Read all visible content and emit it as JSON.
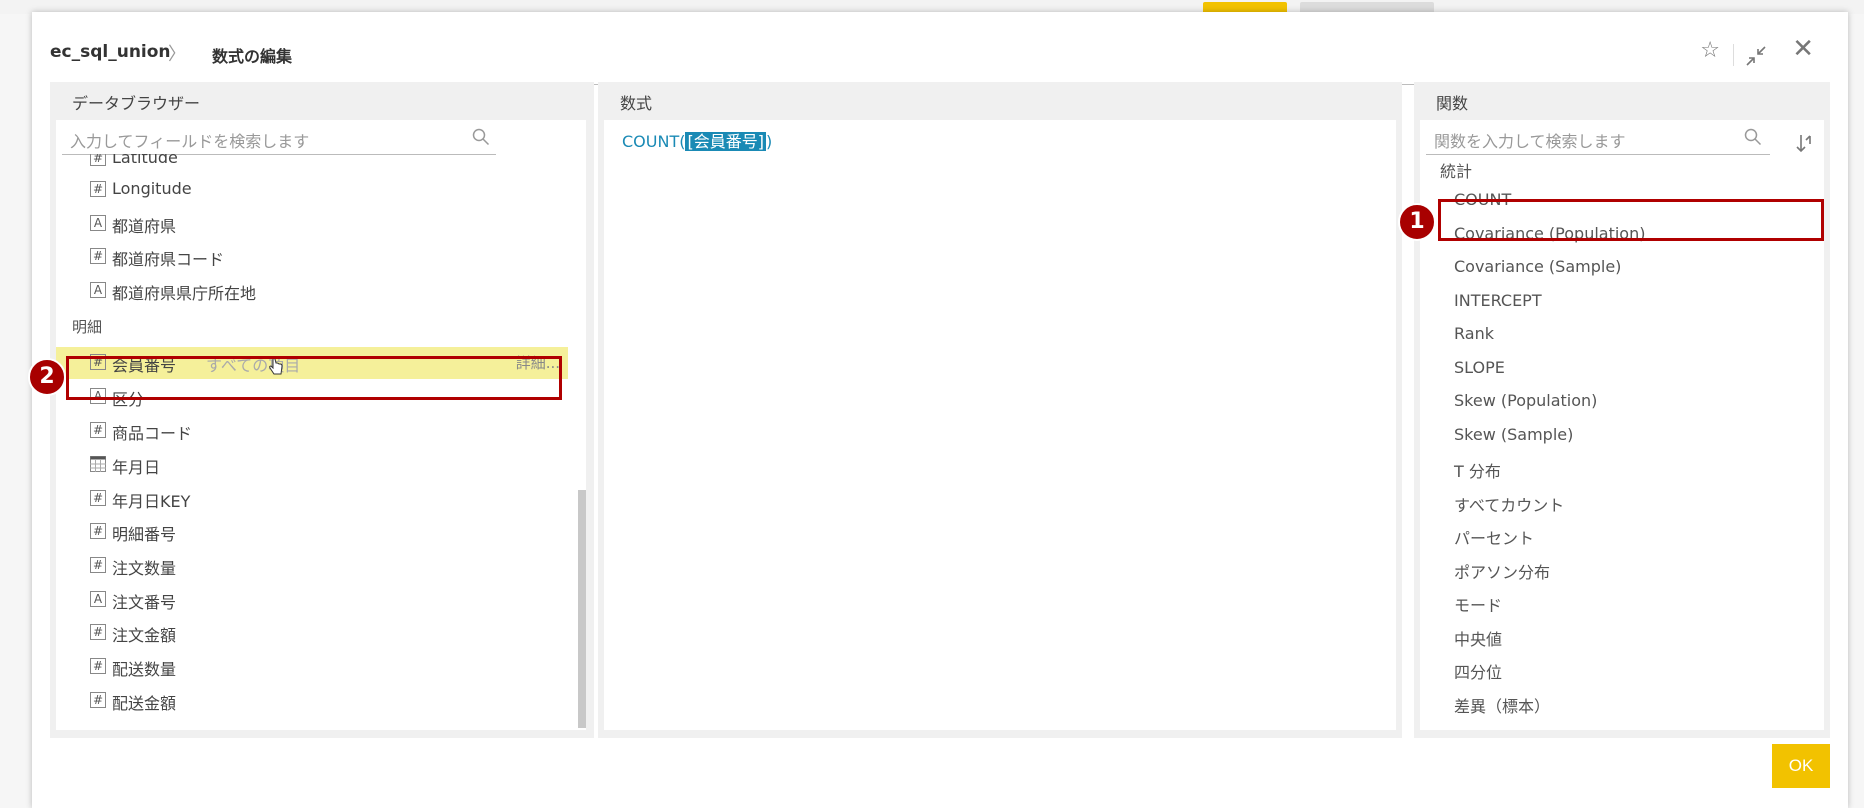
{
  "header": {
    "datasource": "ec_sql_union",
    "separator": "〉",
    "title": "数式の編集"
  },
  "data_browser": {
    "title": "データブラウザー",
    "search_placeholder": "入力してフィールドを検索します",
    "fields_top": [
      {
        "type": "#",
        "label": "Latitude"
      },
      {
        "type": "#",
        "label": "Longitude"
      },
      {
        "type": "A",
        "label": "都道府県"
      },
      {
        "type": "#",
        "label": "都道府県コード"
      },
      {
        "type": "A",
        "label": "都道府県県庁所在地"
      }
    ],
    "section": "明細",
    "highlighted_field": {
      "type": "#",
      "label": "会員番号",
      "sub": "すべての項目",
      "detail": "詳細..."
    },
    "fields_bottom": [
      {
        "type": "A",
        "label": "区分"
      },
      {
        "type": "#",
        "label": "商品コード"
      },
      {
        "type": "cal",
        "label": "年月日"
      },
      {
        "type": "#",
        "label": "年月日KEY"
      },
      {
        "type": "#",
        "label": "明細番号"
      },
      {
        "type": "#",
        "label": "注文数量"
      },
      {
        "type": "A",
        "label": "注文番号"
      },
      {
        "type": "#",
        "label": "注文金額"
      },
      {
        "type": "#",
        "label": "配送数量"
      },
      {
        "type": "#",
        "label": "配送金額"
      }
    ]
  },
  "formula_panel": {
    "title": "数式",
    "func": "COUNT",
    "open": "(",
    "arg": "[会員番号]",
    "close": ")"
  },
  "functions": {
    "title": "関数",
    "search_placeholder": "関数を入力して検索します",
    "category": "統計",
    "items": [
      "COUNT",
      "Covariance (Population)",
      "Covariance (Sample)",
      "INTERCEPT",
      "Rank",
      "SLOPE",
      "Skew (Population)",
      "Skew (Sample)",
      "T 分布",
      "すべてカウント",
      "パーセント",
      "ポアソン分布",
      "モード",
      "中央値",
      "四分位",
      "差異（標本）"
    ]
  },
  "callouts": {
    "one": "1",
    "two": "2"
  },
  "ok_label": "OK",
  "colors": {
    "accent": "#f2c200",
    "formula": "#1a8ab5",
    "callout": "#b00000",
    "highlight": "#f5f09a"
  }
}
